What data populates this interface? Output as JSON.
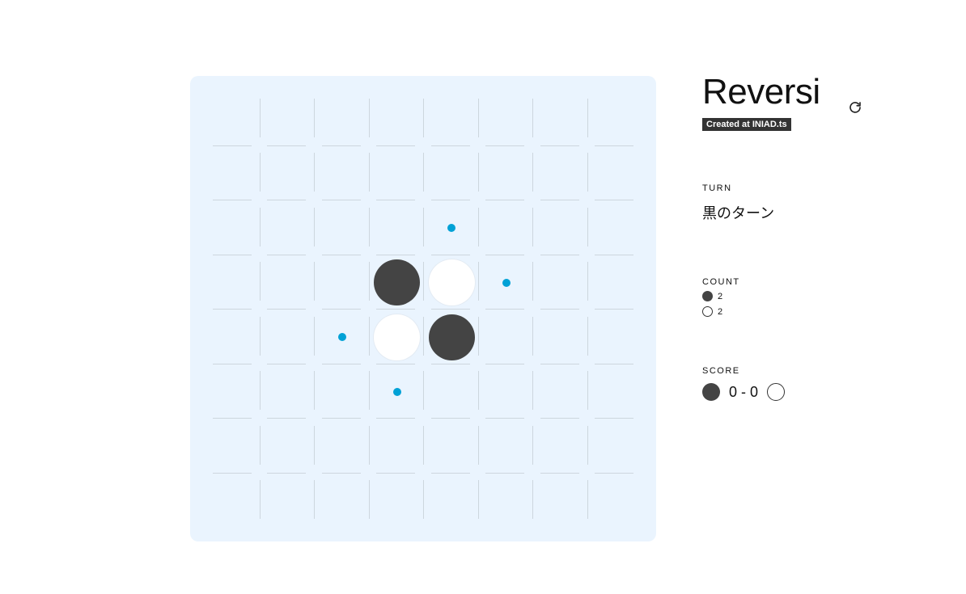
{
  "app": {
    "title": "Reversi",
    "badge": "Created at INIAD.ts"
  },
  "colors": {
    "board": "#eaf4fe",
    "black_stone": "#444444",
    "white_stone": "#ffffff",
    "hint": "#00a1d6",
    "grid_line": "#cdd6de"
  },
  "icons": {
    "reset": "refresh-icon"
  },
  "turn": {
    "label": "TURN",
    "value": "黒のターン"
  },
  "count": {
    "label": "COUNT",
    "black": "2",
    "white": "2"
  },
  "score": {
    "label": "SCORE",
    "text": "0 - 0"
  },
  "board": {
    "size": 8,
    "legend": "0 = empty, 1 = black, 2 = white, 3 = legal move hint",
    "rows": [
      [
        0,
        0,
        0,
        0,
        0,
        0,
        0,
        0
      ],
      [
        0,
        0,
        0,
        0,
        0,
        0,
        0,
        0
      ],
      [
        0,
        0,
        0,
        0,
        3,
        0,
        0,
        0
      ],
      [
        0,
        0,
        0,
        1,
        2,
        3,
        0,
        0
      ],
      [
        0,
        0,
        3,
        2,
        1,
        0,
        0,
        0
      ],
      [
        0,
        0,
        0,
        3,
        0,
        0,
        0,
        0
      ],
      [
        0,
        0,
        0,
        0,
        0,
        0,
        0,
        0
      ],
      [
        0,
        0,
        0,
        0,
        0,
        0,
        0,
        0
      ]
    ]
  }
}
